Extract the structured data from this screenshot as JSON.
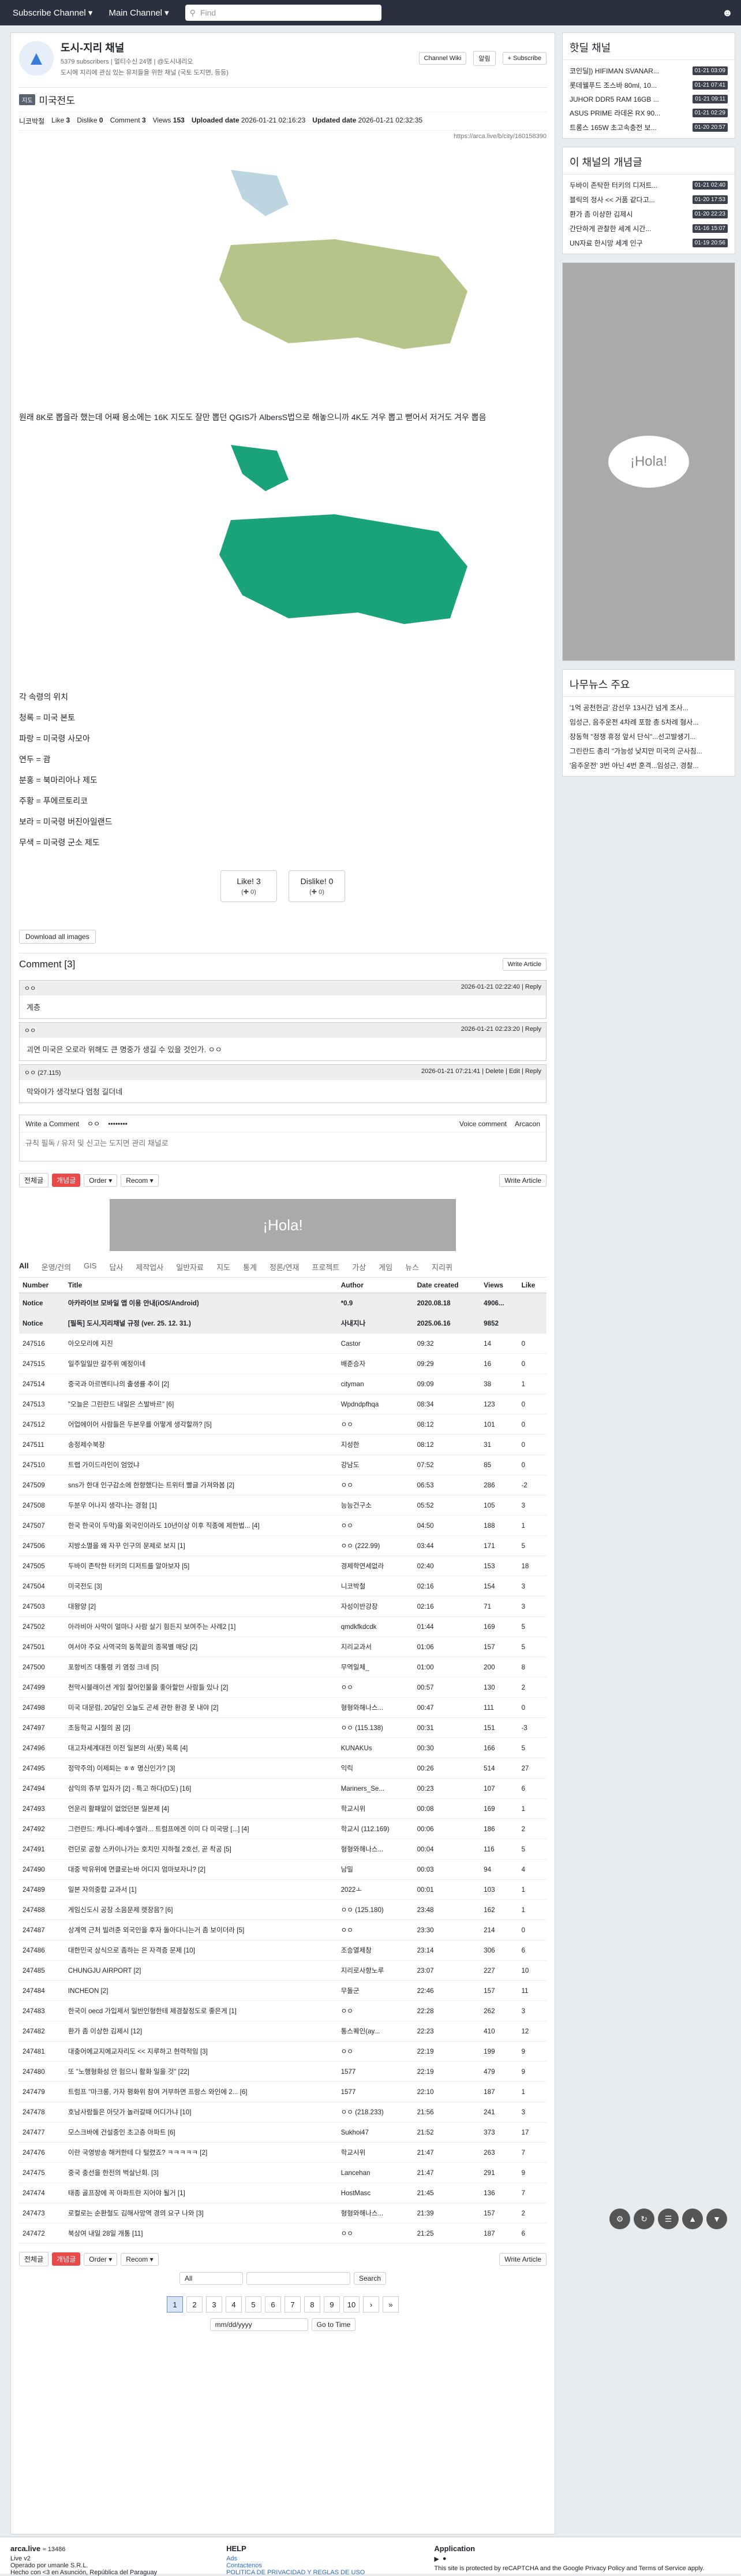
{
  "nav": {
    "subscribe_channel": "Subscribe Channel ▾",
    "main_channel": "Main Channel ▾",
    "search_placeholder": "Find",
    "user_icon": "user-icon"
  },
  "channel": {
    "name": "도시-지리 채널",
    "meta": "5379 subscribers | 멀티수신 24명 | @도시내리오",
    "desc": "도시에 지리에 관심 있는 유저들을 위한 채널 (국토 도지면, 등등)",
    "buttons": {
      "wiki": "Channel Wiki",
      "alarm": "알림",
      "subscribe": "+ Subscribe"
    }
  },
  "post": {
    "tag": "지도",
    "title": "미국전도",
    "author": "니코박철",
    "like_label": "Like",
    "like": "3",
    "dislike_label": "Dislike",
    "dislike": "0",
    "comment_label": "Comment",
    "comment": "3",
    "views_label": "Views",
    "views": "153",
    "uploaded_label": "Uploaded date",
    "uploaded": "2026-01-21 02:16:23",
    "updated_label": "Updated date",
    "updated": "2026-01-21 02:32:35",
    "url": "https://arca.live/b/city/160158390",
    "body_text": "원래 8K로 뽑을라 했는데 어째 용소에는 16K 지도도 잘만 뽑던 QGIS가 AlbersS법으로 해놓으니까 4K도 겨우 뽑고 뻗어서 저거도 겨우 뽑음",
    "legend_lines": [
      "각 속령의 위치",
      "청록 = 미국 본토",
      "파랑 = 미국령 사모아",
      "연두 = 괌",
      "분홍 = 북마리아나 제도",
      "주황 = 푸에르토리코",
      "보라 = 미국령 버진아일랜드",
      "무색 = 미국령 군소 제도"
    ],
    "like_button": "Like! 3",
    "like_sub": "(✚ 0)",
    "dislike_button": "Dislike! 0",
    "dislike_sub": "(✚ 0)",
    "download": "Download all images"
  },
  "comments": {
    "title": "Comment [3]",
    "write_article": "Write Article",
    "items": [
      {
        "author": "ㅇㅇ",
        "date": "2026-01-21 02:22:40",
        "action": "Reply",
        "text": "계층"
      },
      {
        "author": "ㅇㅇ",
        "date": "2026-01-21 02:23:20",
        "action": "Reply",
        "text": "괴연 미국은 오로라 위해도 큰 명중가 생길 수 있을 것인가. ㅇㅇ"
      },
      {
        "author": "ㅇㅇ (27.115)",
        "date": "2026-01-21 07:21:41",
        "action": "Delete | Edit | Reply",
        "text": "막와야가 생각보다 엄청 길더네"
      }
    ],
    "write_label": "Write a Comment",
    "write_user": "ㅇㅇ",
    "password_mask": "••••••••",
    "voice": "Voice comment",
    "arcacon": "Arcacon",
    "placeholder": "규칙 필독 / 유저 및 신고는 도지면 관리 채널로"
  },
  "toolbar": {
    "all": "전체글",
    "best": "개념글",
    "order": "Order ▾",
    "recom": "Recom ▾",
    "write": "Write Article"
  },
  "categories": [
    "All",
    "운영/건의",
    "GIS",
    "답사",
    "제작업사",
    "일반자료",
    "지도",
    "통계",
    "정론/연재",
    "프로젝트",
    "가상",
    "게임",
    "뉴스",
    "지리퀴"
  ],
  "table": {
    "headers": [
      "Number",
      "Title",
      "Author",
      "Date created",
      "Views",
      "Like"
    ],
    "rows": [
      [
        "Notice",
        "아카라이브 모바일 앱 이용 안내(iOS/Android)",
        "*0.9",
        "2020.08.18",
        "4906...",
        ""
      ],
      [
        "Notice",
        "[필독] 도시,지리채널 규정 (ver. 25. 12. 31.)",
        "사내지나",
        "2025.06.16",
        "9852",
        ""
      ],
      [
        "247516",
        "아오모리에 지진",
        "Castor",
        "09:32",
        "14",
        "0"
      ],
      [
        "247515",
        "일주일일만 갈주위 예정이네",
        "배준승자",
        "09:29",
        "16",
        "0"
      ],
      [
        "247514",
        "중국과 아르멘티나의 출생률 추이 [2]",
        "cityman",
        "09:09",
        "38",
        "1"
      ],
      [
        "247513",
        "\"오늘은 그린란드 내일은 스발바르\" [6]",
        "Wpdndpfhqa",
        "08:34",
        "123",
        "0"
      ],
      [
        "247512",
        "어업에이어 사람들은 두본우를 어떻게 생각할까? [5]",
        "ㅇㅇ",
        "08:12",
        "101",
        "0"
      ],
      [
        "247511",
        "송정제수북장",
        "지성한",
        "08:12",
        "31",
        "0"
      ],
      [
        "247510",
        "트랩 가이드라인이 엄었냐",
        "강남도",
        "07:52",
        "85",
        "0"
      ],
      [
        "247509",
        "sns가 한대 인구감소에 한향했다는 트위터 빨글 가져와봄 [2]",
        "ㅇㅇ",
        "06:53",
        "286",
        "-2"
      ],
      [
        "247508",
        "두분우 어나지 생각나는 경험 [1]",
        "능능건구소",
        "05:52",
        "105",
        "3"
      ],
      [
        "247507",
        "한국 한국이 두막)을 외국인이라도 10년이상 이후 직종에 제한법... [4]",
        "ㅇㅇ",
        "04:50",
        "188",
        "1"
      ],
      [
        "247506",
        "지방소멸을 왜 자꾸 인구의 문제로 보지 [1]",
        "ㅇㅇ (222.99)",
        "03:44",
        "171",
        "5"
      ],
      [
        "247505",
        "두바이 존탁한 터키의 디저트를 알아보자 [5]",
        "경제학연세없라",
        "02:40",
        "153",
        "18"
      ],
      [
        "247504",
        "미국전도 [3]",
        "니코박철",
        "02:16",
        "154",
        "3"
      ],
      [
        "247503",
        "대왕양 [2]",
        "자성이반강장",
        "02:16",
        "71",
        "3"
      ],
      [
        "247502",
        "아라비아 사막이 얼마나 사람 살기 힘든지 보여주는 사례2 [1]",
        "qmdkfkdcdk",
        "01:44",
        "169",
        "5"
      ],
      [
        "247501",
        "여서야 주요 사역국의 동쪽끝의 종목별 매당 [2]",
        "지리교과서",
        "01:06",
        "157",
        "5"
      ],
      [
        "247500",
        "포항비즈 대통령 키 염정 크네 [5]",
        "무역일체_",
        "01:00",
        "200",
        "8"
      ],
      [
        "247499",
        "천막시블래이션 게임 찰어인물을 좋아할만 사람들 있나 [2]",
        "ㅇㅇ",
        "00:57",
        "130",
        "2"
      ],
      [
        "247498",
        "미국 대문럼, 20달인 오늘도 곤세 관한 환경 못 내야 [2]",
        "형형와해나스...",
        "00:47",
        "111",
        "0"
      ],
      [
        "247497",
        "초등학교 시절의 꿈 [2]",
        "ㅇㅇ (115.138)",
        "00:31",
        "151",
        "-3"
      ],
      [
        "247496",
        "대고차세계대전 이전 일본의 사(롯) 목록 [4]",
        "KUNAKUs",
        "00:30",
        "166",
        "5"
      ],
      [
        "247495",
        "정막주의) 이제퇴는 ㅎㅎ 명신인가? [3]",
        "익릭",
        "00:26",
        "514",
        "27"
      ],
      [
        "247494",
        "삼익의 쥬부 입자가 [2] - 특고 하다(D도) [16]",
        "Mariners_Se...",
        "00:23",
        "107",
        "6"
      ],
      [
        "247493",
        "언운리 활패알이 없었던본 일본제 [4]",
        "학교시위",
        "00:08",
        "169",
        "1"
      ],
      [
        "247492",
        "그런란드: 캐나다-베네수엘라... 트럼프에겐 이미 다 미국땅 [...] [4]",
        "학교시 (112.169)",
        "00:06",
        "186",
        "2"
      ],
      [
        "247491",
        "런던로 공항 스카이나가는 호치민 지하철 2호선, 곧 착공 [5]",
        "형형와해나스...",
        "00:04",
        "116",
        "5"
      ],
      [
        "247490",
        "대중 박유위에 면클로는바 어디지 엄마보자니? [2]",
        "남밀",
        "00:03",
        "94",
        "4"
      ],
      [
        "247489",
        "일본 자의중합 교과서 [1]",
        "2022ㅗ",
        "00:01",
        "103",
        "1"
      ],
      [
        "247488",
        "게임신도시 공장 소음문제 렛장음? [6]",
        "ㅇㅇ (125.180)",
        "23:48",
        "162",
        "1"
      ],
      [
        "247487",
        "상계역 근처 빌려준 외국인을 후자 돌아다니는거 좀 보이더라 [5]",
        "ㅇㅇ",
        "23:30",
        "214",
        "0"
      ],
      [
        "247486",
        "대한민국 상식으로 좀하는 은 자격증 문제 [10]",
        "조승열제창",
        "23:14",
        "306",
        "6"
      ],
      [
        "247485",
        "CHUNGJU AIRPORT [2]",
        "지리로사향노루",
        "23:07",
        "227",
        "10"
      ],
      [
        "247484",
        "INCHEON [2]",
        "무돌군",
        "22:46",
        "157",
        "11"
      ],
      [
        "247483",
        "한국이 oecd 가입제서 일반인형한테 제경찰정도로 좋은게 [1]",
        "ㅇㅇ",
        "22:28",
        "262",
        "3"
      ],
      [
        "247482",
        "환가 좀 이상한 김제시 [12]",
        "통스퀘인(ay...",
        "22:23",
        "410",
        "12"
      ],
      [
        "247481",
        "대충어에교지에교자리도 << 지루하고 현력적임 [3]",
        "ㅇㅇ",
        "22:19",
        "199",
        "9"
      ],
      [
        "247480",
        "또 \"노행형화성 안 험으니 활화 일을 것\" [22]",
        "1577",
        "22:19",
        "479",
        "9"
      ],
      [
        "247479",
        "트럼프 \"마크롱, 가자 평화위 참여 거부하면 프랑스 와인에 2... [6]",
        "1577",
        "22:10",
        "187",
        "1"
      ],
      [
        "247478",
        "호남사람들은 아닷가 놀러갈때 어디가냐 [10]",
        "ㅇㅇ (218.233)",
        "21:56",
        "241",
        "3"
      ],
      [
        "247477",
        "모스크바에 건설중인 초고층 아파트 [6]",
        "Sukhoi47",
        "21:52",
        "373",
        "17"
      ],
      [
        "247476",
        "이란 국영방송 해커한테 다 털렸죠? ㅋㅋㅋㅋㅋ [2]",
        "학교시위",
        "21:47",
        "263",
        "7"
      ],
      [
        "247475",
        "중국 충선을 한전의 벅살난회. [3]",
        "Lancehan",
        "21:47",
        "291",
        "9"
      ],
      [
        "247474",
        "태종 골프장에 꼭 아파트란 지어야 될거 [1]",
        "HostMasc",
        "21:45",
        "136",
        "7"
      ],
      [
        "247473",
        "로컬로는 순환철도 김해사망역 경의 요구 나와 [3]",
        "형형와해나스...",
        "21:39",
        "157",
        "2"
      ],
      [
        "247472",
        "북상여 내일 28일 개통 [11]",
        "ㅇㅇ",
        "21:25",
        "187",
        "6"
      ]
    ]
  },
  "pagination": {
    "pages": [
      "1",
      "2",
      "3",
      "4",
      "5",
      "6",
      "7",
      "8",
      "9",
      "10"
    ],
    "search_scope": "All",
    "search_btn": "Search",
    "date_placeholder": "mm/dd/yyyy",
    "goto": "Go to Time"
  },
  "sidebar": {
    "hot_title": "핫딜 채널",
    "hot": [
      {
        "t": "코인딜]) HIFIMAN SVANAR...",
        "time": "01-21 03:09"
      },
      {
        "t": "롯데웰푸드 조스바 80ml, 10...",
        "time": "01-21 07:41"
      },
      {
        "t": "JUHOR DDR5 RAM 16GB ...",
        "time": "01-21 09:11"
      },
      {
        "t": "ASUS PRIME 라데온 RX 90...",
        "time": "01-21 02:29"
      },
      {
        "t": "트롱스 165W 초고속충전 보...",
        "time": "01-20 20:57"
      }
    ],
    "concept_title": "이 채널의 개념글",
    "concept": [
      {
        "t": "두바이 존탁한 터키의 디저트...",
        "time": "01-21 02:40"
      },
      {
        "t": "블릭의 정사 << 거품 같다고...",
        "time": "01-20 17:53"
      },
      {
        "t": "환가 좀 이상한 김제시",
        "time": "01-20 22:23"
      },
      {
        "t": "간단하게 관찰한 세계 시간...",
        "time": "01-16 15:07"
      },
      {
        "t": "UN자료 한시망 세계 인구",
        "time": "01-19 20:56"
      }
    ],
    "ad_text": "¡Hola!",
    "news_title": "나무뉴스 주요",
    "news": [
      "'1억 공천헌금' 강선우 13시간 넘게 조사...",
      "임성근, 음주운전 4차례 포함 총 5차례 형사...",
      "장동혁 \"정쟁 휴정 앞서 단식\"...선고발생기...",
      "그린란드 총리 \"가능성 낮지만 미국의 군사침...",
      "'음주운전' 3번 아닌 4번 훈격...임성근, 경찰..."
    ]
  },
  "footer": {
    "brand": "arca.live",
    "users": "≈ 13486",
    "version": "Live v2",
    "operator": "Operado por umanle S.R.L.",
    "made": "Hecho con <3 en Asunción, República del Paraguay",
    "help": "HELP",
    "help1": "Ads",
    "help2": "Contactenos",
    "help3": "POLITICA DE PRIVACIDAD Y REGLAS DE USO",
    "app": "Application",
    "recaptcha": "This site is protected by reCAPTCHA and the Google Privacy Policy and Terms of Service apply."
  }
}
